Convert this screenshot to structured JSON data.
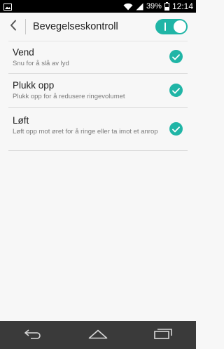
{
  "status": {
    "battery_percent": "39%",
    "time": "12:14"
  },
  "appbar": {
    "title": "Bevegelseskontroll",
    "master_toggle_on": true
  },
  "items": [
    {
      "title": "Vend",
      "subtitle": "Snu for å slå av lyd",
      "checked": true
    },
    {
      "title": "Plukk opp",
      "subtitle": "Plukk opp for å redusere ringevolumet",
      "checked": true
    },
    {
      "title": "Løft",
      "subtitle": "Løft opp mot øret for å ringe eller ta imot et anrop",
      "checked": true
    }
  ],
  "colors": {
    "accent": "#20b5a6",
    "statusbar": "#000000",
    "navbar": "#3a3a3a"
  },
  "icons": {
    "statusbar": [
      "image-notification-icon",
      "wifi-icon",
      "signal-icon",
      "battery-icon"
    ],
    "navbar": [
      "back-icon",
      "home-icon",
      "recents-icon"
    ]
  }
}
